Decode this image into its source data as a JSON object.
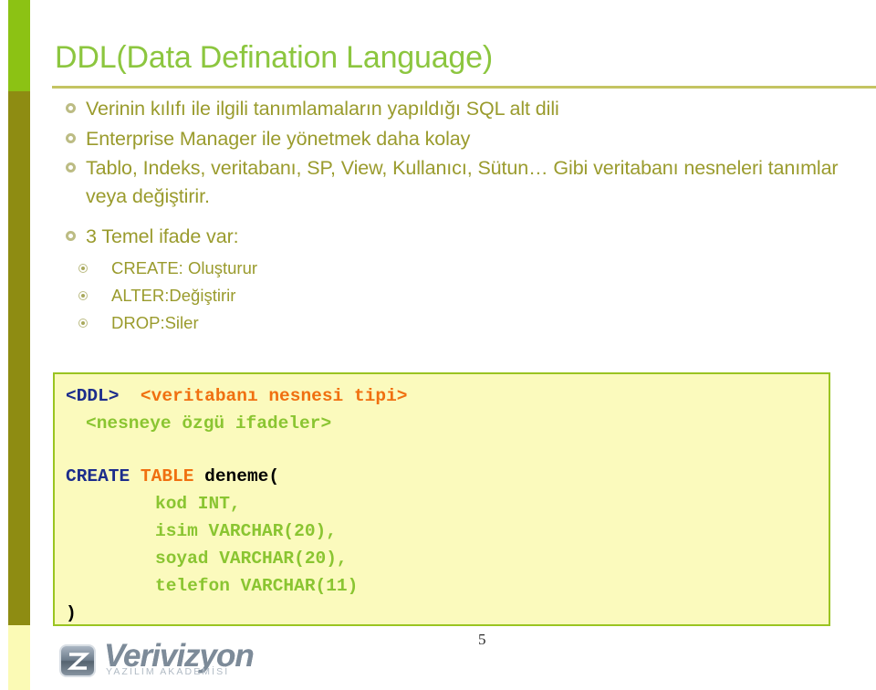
{
  "slide": {
    "title": "DDL(Data Defination Language)",
    "page_number": "5",
    "accent_colors": {
      "title_green": "#8cc63f",
      "strip_green": "#8cc214",
      "strip_olive": "#8e8c12",
      "strip_pale": "#fbfab5",
      "body_olive": "#9a9b2d",
      "rule": "#c4c462",
      "code_bg": "#fbfabd",
      "code_border": "#9ac422",
      "code_keyword_blue": "#1c2d8c",
      "code_type_orange": "#f07010",
      "code_field_green": "#8ac531",
      "code_plain_black": "#000000"
    }
  },
  "bullets": [
    {
      "text": "Verinin kılıfı ile ilgili tanımlamaların yapıldığı SQL alt dili"
    },
    {
      "text": "Enterprise Manager ile yönetmek daha kolay"
    },
    {
      "text": "Tablo, Indeks, veritabanı, SP, View, Kullanıcı, Sütun… Gibi veritabanı nesneleri tanımlar veya değiştirir."
    },
    {
      "text": "3 Temel ifade var:"
    }
  ],
  "sub_bullets": [
    {
      "text": "CREATE: Oluşturur"
    },
    {
      "text": "ALTER:Değiştirir"
    },
    {
      "text": "DROP:Siler"
    }
  ],
  "code": {
    "line1_tag": "<DDL>",
    "line1_rest": "<veritabanı nesnesi tipi>",
    "line2": "<nesneye özgü ifadeler>",
    "line3_create": "CREATE",
    "line3_table": "TABLE",
    "line3_name": "deneme(",
    "line4": "kod INT,",
    "line5": "isim VARCHAR(20),",
    "line6": "soyad VARCHAR(20),",
    "line7": "telefon VARCHAR(11)",
    "line8": ")"
  },
  "logo": {
    "name": "Verivizyon",
    "tagline": "YAZILIM AKADEMİSİ",
    "mark_letter": "z"
  }
}
